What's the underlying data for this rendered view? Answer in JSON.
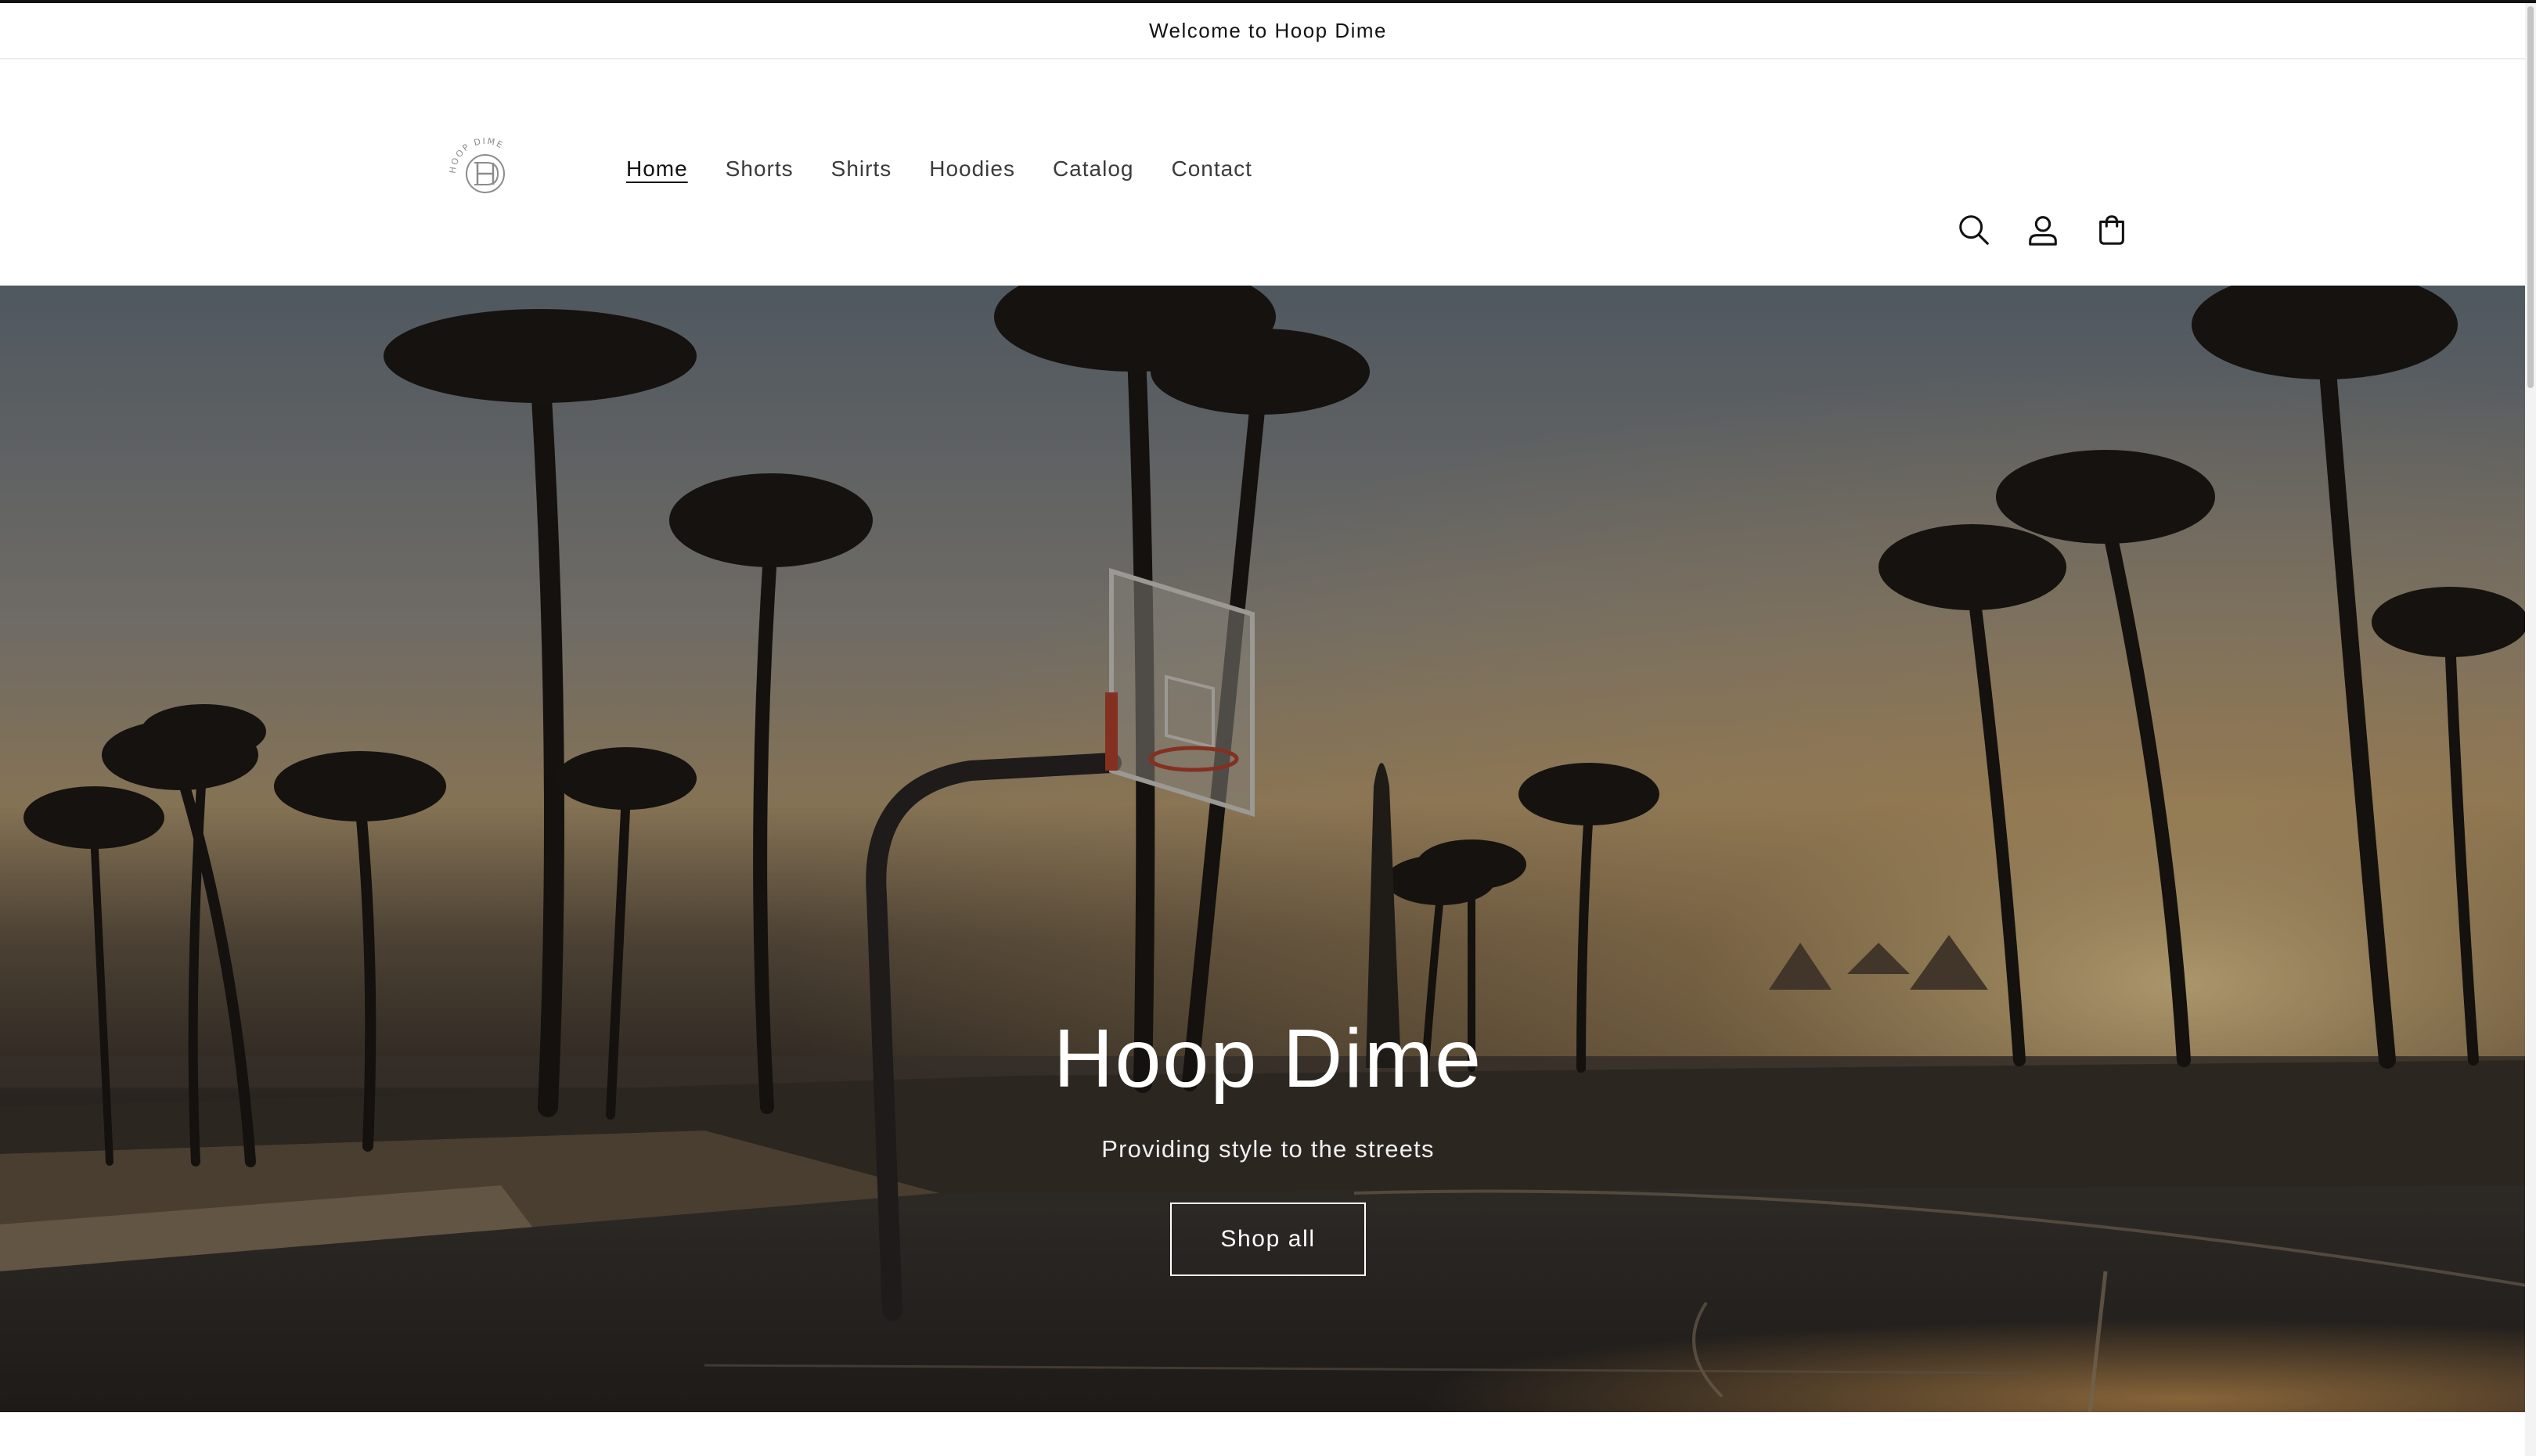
{
  "announcement": {
    "text": "Welcome to Hoop Dime"
  },
  "header": {
    "logo": {
      "ring_text": "HOOP DIME",
      "icon": "hoop-dime-monogram-icon"
    },
    "nav": [
      {
        "label": "Home",
        "active": true
      },
      {
        "label": "Shorts",
        "active": false
      },
      {
        "label": "Shirts",
        "active": false
      },
      {
        "label": "Hoodies",
        "active": false
      },
      {
        "label": "Catalog",
        "active": false
      },
      {
        "label": "Contact",
        "active": false
      }
    ],
    "icons": [
      "search-icon",
      "account-icon",
      "cart-icon"
    ]
  },
  "hero": {
    "title": "Hoop Dime",
    "subtitle": "Providing style to the streets",
    "button_label": "Shop all"
  },
  "colors": {
    "text": "#121212",
    "nav_text": "#3b3b3b",
    "divider": "#ececec",
    "hero_text": "#ffffff"
  }
}
